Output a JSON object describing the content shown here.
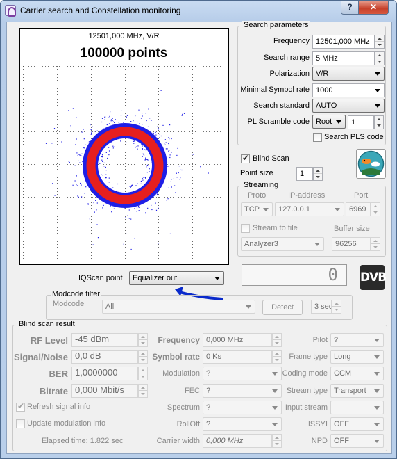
{
  "window": {
    "title": "Carrier search and Constellation monitoring",
    "help_label": "?",
    "close_label": "✕"
  },
  "scope": {
    "freq_label": "12501,000 MHz, V/R",
    "points_label": "100000 points"
  },
  "search_params": {
    "title": "Search parameters",
    "frequency_label": "Frequency",
    "frequency_value": "12501,000 MHz",
    "range_label": "Search range",
    "range_value": "5 MHz",
    "polarization_label": "Polarization",
    "polarization_value": "V/R",
    "symrate_label": "Minimal Symbol rate",
    "symrate_value": "1000",
    "standard_label": "Search standard",
    "standard_value": "AUTO",
    "pl_label": "PL Scramble code",
    "pl_mode": "Root",
    "pl_value": "1",
    "search_pls_label": "Search PLS code",
    "search_pls_checked": false
  },
  "blind_scan": {
    "label": "Blind Scan",
    "checked": true,
    "point_size_label": "Point size",
    "point_size_value": "1"
  },
  "streaming": {
    "title": "Streaming",
    "proto_header": "Proto",
    "ip_header": "IP-address",
    "port_header": "Port",
    "proto_value": "TCP",
    "ip_value": "127.0.0.1",
    "port_value": "6969",
    "stream_to_file_label": "Stream to file",
    "buffer_size_label": "Buffer size",
    "file_value": "Analyzer3",
    "buffer_value": "96256"
  },
  "iqscan": {
    "label": "IQScan point",
    "value": "Equalizer out"
  },
  "lcd_value": "0",
  "dvb_logo": "DVB",
  "modcode_filter": {
    "title": "Modcode filter",
    "modcode_label": "Modcode",
    "modcode_value": "All",
    "detect_label": "Detect",
    "interval_value": "3 sec"
  },
  "result": {
    "title": "Blind scan result",
    "rf_level_label": "RF Level",
    "rf_level_value": "-45 dBm",
    "snr_label": "Signal/Noise",
    "snr_value": "0,0 dB",
    "ber_label": "BER",
    "ber_value": "1,0000000",
    "bitrate_label": "Bitrate",
    "bitrate_value": "0,000 Mbit/s",
    "frequency_label": "Frequency",
    "frequency_value": "0,000 MHz",
    "symrate_label": "Symbol rate",
    "symrate_value": "0 Ks",
    "modulation_label": "Modulation",
    "modulation_value": "?",
    "fec_label": "FEC",
    "fec_value": "?",
    "spectrum_label": "Spectrum",
    "spectrum_value": "?",
    "rolloff_label": "RollOff",
    "rolloff_value": "?",
    "carrier_width_label": "Carrier width",
    "carrier_width_value": "0,000 MHz",
    "pilot_label": "Pilot",
    "pilot_value": "?",
    "frame_type_label": "Frame type",
    "frame_type_value": "Long",
    "coding_mode_label": "Coding mode",
    "coding_mode_value": "CCM",
    "stream_type_label": "Stream type",
    "stream_type_value": "Transport",
    "input_stream_label": "Input stream",
    "input_stream_value": "",
    "issyi_label": "ISSYI",
    "issyi_value": "OFF",
    "npd_label": "NPD",
    "npd_value": "OFF",
    "refresh_label": "Refresh signal info",
    "refresh_checked": true,
    "update_mod_label": "Update modulation info",
    "update_mod_checked": false,
    "elapsed_label": "Elapsed time: 1.822 sec"
  },
  "colors": {
    "ring_outer": "#1f1fe6",
    "ring_inner": "#e61f1f",
    "annotation": "#0a2acb"
  },
  "icons": [
    "app-icon",
    "help-icon",
    "close-icon",
    "fish-logo-icon",
    "dvb-logo-icon",
    "dropdown-arrow-icon",
    "spin-arrows-icon",
    "checkbox-icon"
  ]
}
